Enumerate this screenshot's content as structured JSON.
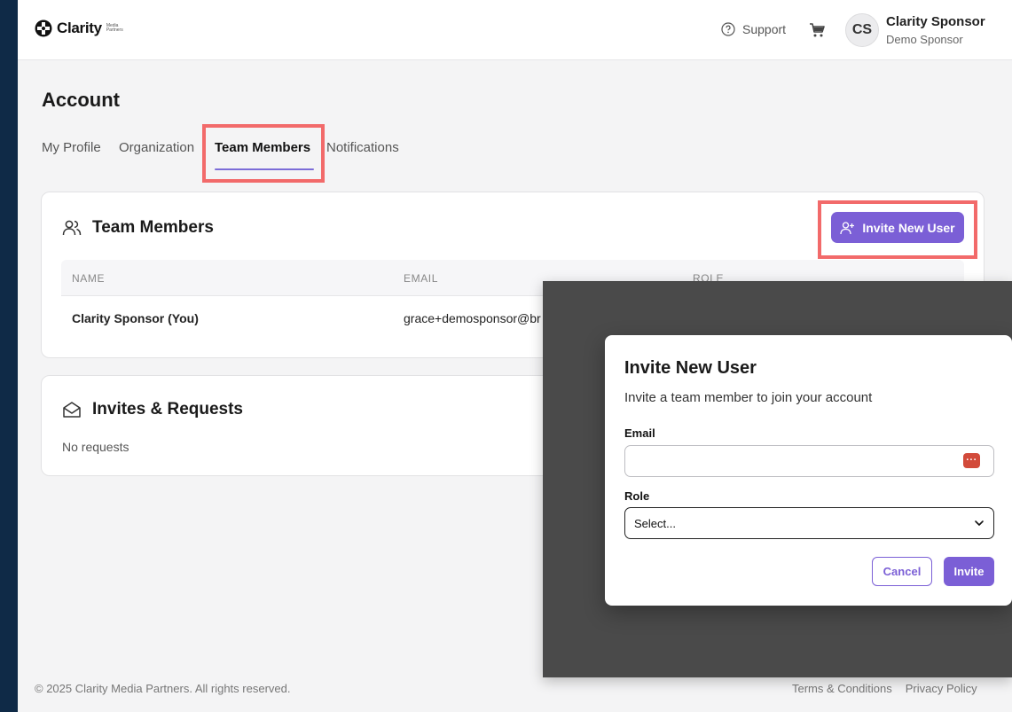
{
  "header": {
    "logo_text": "Clarity",
    "logo_sub": "Media Partners",
    "support_label": "Support",
    "user": {
      "initials": "CS",
      "name": "Clarity Sponsor",
      "org": "Demo Sponsor"
    }
  },
  "page": {
    "title": "Account",
    "tabs": [
      {
        "label": "My Profile",
        "active": false
      },
      {
        "label": "Organization",
        "active": false
      },
      {
        "label": "Team Members",
        "active": true
      },
      {
        "label": "Notifications",
        "active": false
      }
    ]
  },
  "team_members": {
    "title": "Team Members",
    "invite_button": "Invite New User",
    "columns": [
      "NAME",
      "EMAIL",
      "ROLE"
    ],
    "rows": [
      {
        "name": "Clarity Sponsor (You)",
        "email": "grace+demosponsor@br"
      }
    ]
  },
  "invites": {
    "title": "Invites & Requests",
    "empty_text": "No requests"
  },
  "footer": {
    "copyright": "© 2025 Clarity Media Partners. All rights reserved.",
    "links": [
      "Terms & Conditions",
      "Privacy Policy"
    ]
  },
  "modal": {
    "title": "Invite New User",
    "subtitle": "Invite a team member to join your account",
    "email_label": "Email",
    "email_value": "",
    "email_placeholder": "",
    "role_label": "Role",
    "role_value": "Select...",
    "cancel_label": "Cancel",
    "submit_label": "Invite",
    "password_manager_badge": "···"
  },
  "colors": {
    "accent": "#7b5fd6",
    "highlight": "#f26a6a",
    "frame": "#0f2a47"
  }
}
